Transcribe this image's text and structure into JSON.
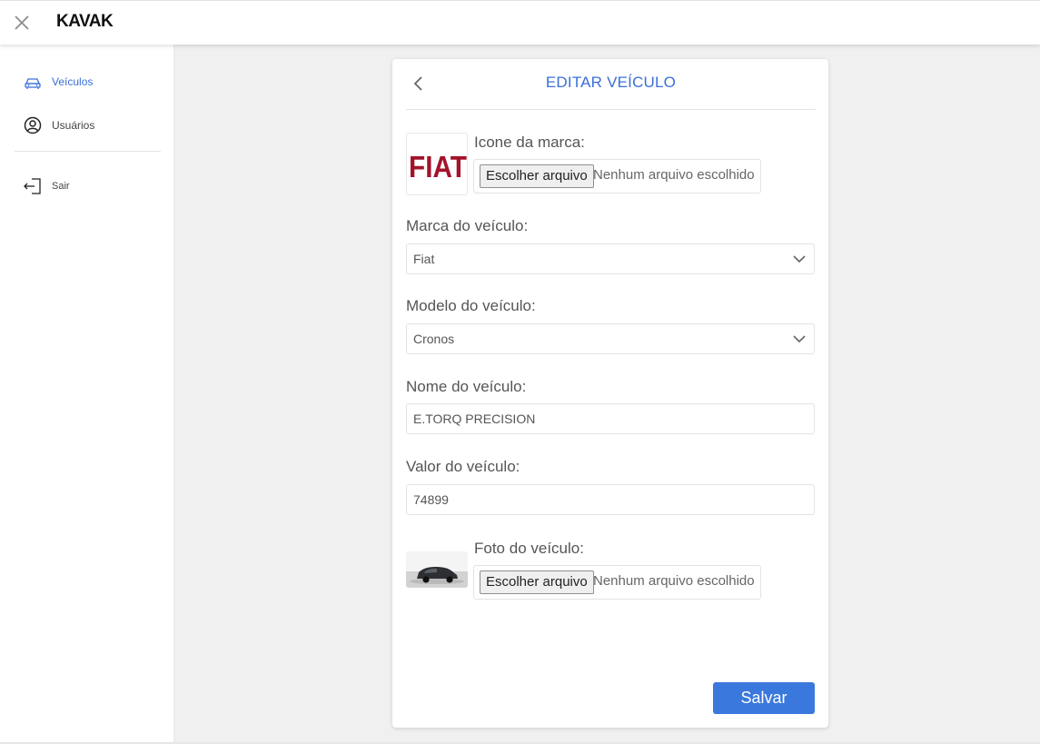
{
  "brand": {
    "logo_text": "KAVAK"
  },
  "sidebar": {
    "items": [
      {
        "label": "Veículos",
        "icon": "car-icon",
        "active": true
      },
      {
        "label": "Usuários",
        "icon": "user-circle-icon",
        "active": false
      },
      {
        "label": "Sair",
        "icon": "logout-icon",
        "active": false
      }
    ]
  },
  "form": {
    "title": "EDITAR VEÍCULO",
    "brand_icon": {
      "label": "Icone da marca:",
      "thumbnail_text": "FIAT",
      "file_button": "Escolher arquivo",
      "file_status": "Nenhum arquivo escolhido"
    },
    "brand": {
      "label": "Marca do veículo:",
      "value": "Fiat"
    },
    "model": {
      "label": "Modelo do veículo:",
      "value": "Cronos"
    },
    "name": {
      "label": "Nome do veículo:",
      "value": "E.TORQ PRECISION"
    },
    "price": {
      "label": "Valor do veículo:",
      "value": "74899"
    },
    "photo": {
      "label": "Foto do veículo:",
      "file_button": "Escolher arquivo",
      "file_status": "Nenhum arquivo escolhido"
    },
    "save_label": "Salvar"
  },
  "colors": {
    "accent": "#3a6fd8",
    "button": "#3a78dd",
    "fiat_red": "#a3122b"
  }
}
